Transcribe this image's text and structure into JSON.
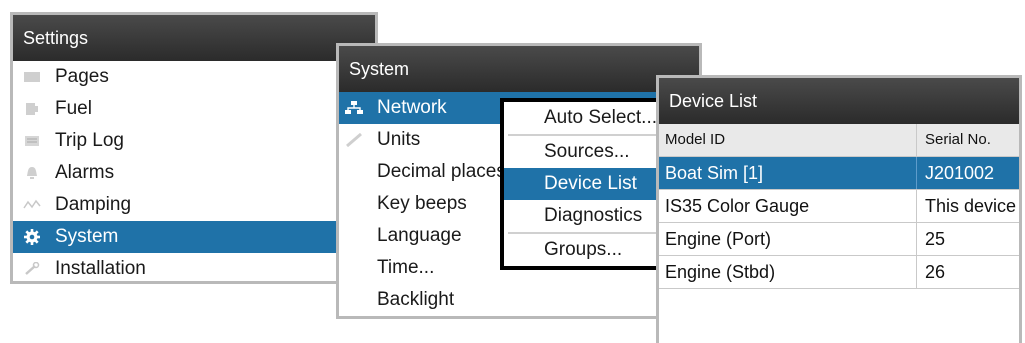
{
  "settings": {
    "title": "Settings",
    "items": [
      {
        "label": "Pages",
        "icon": "pages-icon"
      },
      {
        "label": "Fuel",
        "icon": "fuel-icon"
      },
      {
        "label": "Trip Log",
        "icon": "trip-log-icon"
      },
      {
        "label": "Alarms",
        "icon": "bell-icon"
      },
      {
        "label": "Damping",
        "icon": "damping-icon"
      },
      {
        "label": "System",
        "icon": "gear-icon",
        "selected": true
      },
      {
        "label": "Installation",
        "icon": "wrench-icon"
      }
    ]
  },
  "system": {
    "title": "System",
    "items": [
      {
        "label": "Network",
        "icon": "network-icon",
        "selected": true
      },
      {
        "label": "Units",
        "icon": "ruler-icon"
      },
      {
        "label": "Decimal places"
      },
      {
        "label": "Key beeps"
      },
      {
        "label": "Language"
      },
      {
        "label": "Time..."
      },
      {
        "label": "Backlight"
      }
    ]
  },
  "network_menu": {
    "items": [
      {
        "label": "Auto Select..."
      },
      {
        "label": "Sources..."
      },
      {
        "label": "Device List",
        "selected": true
      },
      {
        "label": "Diagnostics"
      },
      {
        "label": "Groups..."
      }
    ]
  },
  "device_list": {
    "title": "Device List",
    "columns": [
      "Model ID",
      "Serial No."
    ],
    "rows": [
      {
        "model": "Boat Sim [1]",
        "serial": "J201002",
        "selected": true
      },
      {
        "model": "IS35 Color Gauge",
        "serial": "This device"
      },
      {
        "model": "Engine (Port)",
        "serial": "25"
      },
      {
        "model": "Engine (Stbd)",
        "serial": "26"
      }
    ]
  },
  "colors": {
    "accent": "#1f72a8",
    "titlebar": "#2b2b2b",
    "border": "#b9b9b9"
  }
}
